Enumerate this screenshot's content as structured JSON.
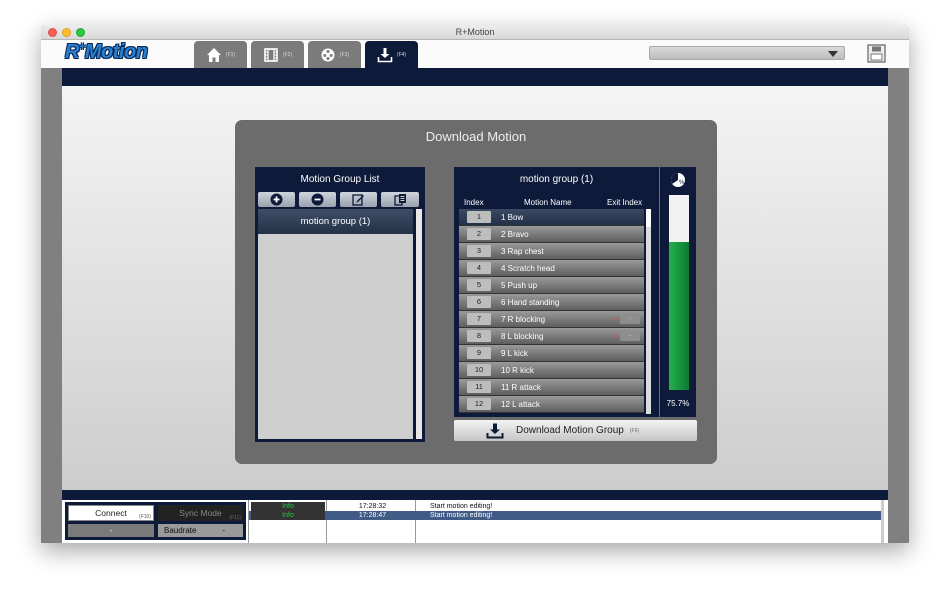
{
  "window": {
    "title": "R+Motion"
  },
  "logo": {
    "prefix": "R",
    "plus": "+",
    "rest": "Motion"
  },
  "tabs": [
    {
      "icon": "home-icon",
      "key": "(F1)"
    },
    {
      "icon": "film-icon",
      "key": "(F2)"
    },
    {
      "icon": "film-reel-icon",
      "key": "(F3)"
    },
    {
      "icon": "download-icon",
      "key": "(F4)",
      "active": true
    }
  ],
  "toolbar": {
    "dropdown_value": ""
  },
  "download_panel": {
    "title": "Download Motion",
    "motion_group_list": {
      "title": "Motion Group List",
      "items": [
        "motion group (1)"
      ]
    },
    "motion_group": {
      "title": "motion group (1)",
      "headers": {
        "index": "Index",
        "name": "Motion Name",
        "exit": "Exit Index"
      },
      "rows": [
        {
          "index": "1",
          "name": "1 Bow"
        },
        {
          "index": "2",
          "name": "2 Bravo"
        },
        {
          "index": "3",
          "name": "3 Rap chest"
        },
        {
          "index": "4",
          "name": "4 Scratch head"
        },
        {
          "index": "5",
          "name": "5 Push up"
        },
        {
          "index": "6",
          "name": "6 Hand standing"
        },
        {
          "index": "7",
          "name": "7 R blocking",
          "exit": "-"
        },
        {
          "index": "8",
          "name": "8 L blocking",
          "exit": "-"
        },
        {
          "index": "9",
          "name": "9 L kick"
        },
        {
          "index": "10",
          "name": "10 R kick"
        },
        {
          "index": "11",
          "name": "11 R attack"
        },
        {
          "index": "12",
          "name": "12 L attack"
        }
      ]
    },
    "memory": {
      "percent_label": "75.7%",
      "fraction": 0.757
    },
    "download_button": {
      "label": "Download Motion Group",
      "key": "(F6)"
    }
  },
  "status": {
    "connect_label": "Connect",
    "connect_key": "(F10)",
    "sync_label": "Sync Mode",
    "sync_key": "(F11)",
    "port_value": "-",
    "baud_label": "Baudrate",
    "baud_value": "-",
    "log": [
      {
        "level": "Info",
        "time": "17:28:32",
        "message": "Start motion editing!"
      },
      {
        "level": "Info",
        "time": "17:28:47",
        "message": "Start motion editing!"
      }
    ]
  },
  "colors": {
    "navy": "#0d1a3a",
    "gauge_green": "#22b14c",
    "info_green": "#22c84a"
  }
}
